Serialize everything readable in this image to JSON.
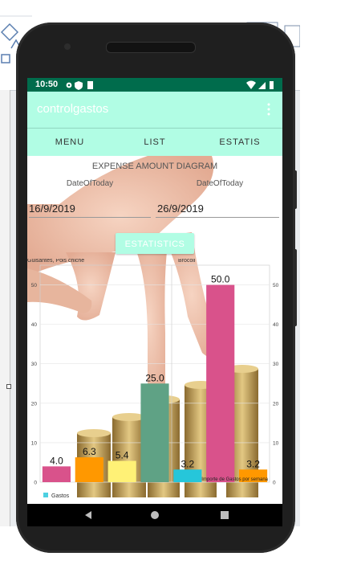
{
  "status_bar": {
    "time": "10:50"
  },
  "app_bar": {
    "title": "controlgastos",
    "menu_icon": "overflow-menu-icon"
  },
  "tabs": [
    {
      "label": "MENU"
    },
    {
      "label": "LIST"
    },
    {
      "label": "ESTATIS"
    }
  ],
  "header": {
    "title": "EXPENSE AMOUNT DIAGRAM",
    "label_from": "DateOfToday",
    "label_to": "DateOfToday",
    "date_from": "16/9/2019",
    "date_to": "26/9/2019",
    "button_label": "ESTATISTICS"
  },
  "colors": {
    "accent": "#b1fde4",
    "status_bar": "#006c4c",
    "button": "#b1fde4"
  },
  "chart_data": {
    "type": "bar",
    "category_labels": [
      "Guisantes, Pois chiche",
      "Brocoli"
    ],
    "values": [
      4.0,
      6.3,
      5.4,
      25.0,
      3.2,
      50.0,
      3.2
    ],
    "value_labels": [
      "4.0",
      "6.3",
      "5.4",
      "25.0",
      "3.2",
      "50.0",
      "3.2"
    ],
    "bar_colors": [
      "#d9528b",
      "#ff9800",
      "#fff176",
      "#5fa285",
      "#26c6da",
      "#d9528b",
      "#ff9800"
    ],
    "ylim": [
      0,
      55
    ],
    "yticks": [
      "0",
      "10",
      "20",
      "30",
      "40",
      "50"
    ],
    "legend": {
      "label": "Gastos",
      "color": "#4dd0e1",
      "placement": "bottom-left"
    },
    "description": "Importe de Gastos por semana",
    "grid": true
  },
  "nav": {
    "back_icon": "back-triangle-icon",
    "home_icon": "home-circle-icon",
    "recents_icon": "recents-square-icon"
  }
}
